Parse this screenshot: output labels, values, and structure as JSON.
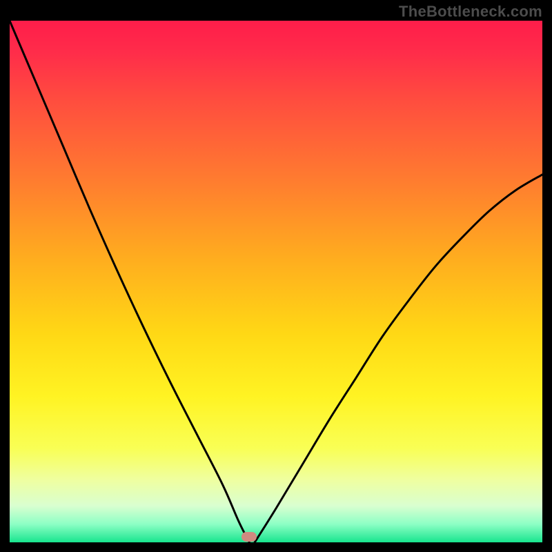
{
  "watermark": "TheBottleneck.com",
  "gradient_stops": [
    {
      "offset": 0,
      "color": "#ff1d4a"
    },
    {
      "offset": 0.06,
      "color": "#ff2c4a"
    },
    {
      "offset": 0.15,
      "color": "#ff4c3f"
    },
    {
      "offset": 0.3,
      "color": "#ff7a30"
    },
    {
      "offset": 0.45,
      "color": "#ffab1f"
    },
    {
      "offset": 0.6,
      "color": "#ffd815"
    },
    {
      "offset": 0.72,
      "color": "#fff323"
    },
    {
      "offset": 0.82,
      "color": "#f9ff55"
    },
    {
      "offset": 0.88,
      "color": "#efffa0"
    },
    {
      "offset": 0.93,
      "color": "#d9ffd0"
    },
    {
      "offset": 0.965,
      "color": "#8dffc5"
    },
    {
      "offset": 1.0,
      "color": "#18e58e"
    }
  ],
  "marker": {
    "x_frac": 0.45,
    "y_frac": 0.992,
    "color": "#d08a80"
  },
  "chart_data": {
    "type": "line",
    "title": "",
    "xlabel": "",
    "ylabel": "",
    "xlim": [
      0,
      1
    ],
    "ylim": [
      0,
      1
    ],
    "note": "V-shaped bottleneck curve. x is normalized horizontal position (0=left edge of plot, 1=right). y is normalized value (0=bottom/green, 1=top/red). Minimum (no bottleneck) near x≈0.45 where a small salmon marker sits. Left branch starts at top-left corner; right branch rises to ~0.70 at x=1.",
    "series": [
      {
        "name": "left-branch",
        "x": [
          0.0,
          0.05,
          0.1,
          0.15,
          0.2,
          0.25,
          0.3,
          0.35,
          0.4,
          0.43,
          0.45
        ],
        "y": [
          1.0,
          0.88,
          0.76,
          0.64,
          0.525,
          0.415,
          0.31,
          0.21,
          0.11,
          0.04,
          0.0
        ]
      },
      {
        "name": "right-branch",
        "x": [
          0.46,
          0.5,
          0.55,
          0.6,
          0.65,
          0.7,
          0.75,
          0.8,
          0.85,
          0.9,
          0.95,
          1.0
        ],
        "y": [
          0.0,
          0.065,
          0.15,
          0.235,
          0.315,
          0.395,
          0.465,
          0.53,
          0.585,
          0.635,
          0.675,
          0.705
        ]
      }
    ],
    "background": "vertical rainbow gradient from red (top, high bottleneck) to green (bottom, no bottleneck)"
  }
}
